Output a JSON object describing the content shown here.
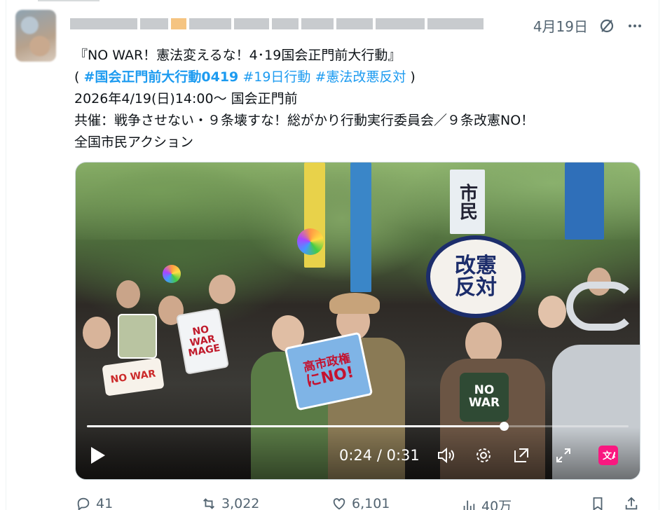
{
  "header": {
    "date": "4月19日",
    "grok_icon": "grok-slash-icon",
    "more_icon": "more-dots-icon"
  },
  "tweet": {
    "line1": "『NO WAR！憲法変えるな！4･19国会正門前大行動』",
    "line2_open": "( ",
    "hashtag1": "#国会正門前大行動0419",
    "hashtag2": "#19日行動",
    "hashtag3": "#憲法改悪反対",
    "line2_close": " )",
    "line3": "2026年4/19(日)14:00～ 国会正門前",
    "line4": "共催：戦争させない・９条壊すな！総がかり行動実行委員会／９条改憲NO！",
    "line5": "全国市民アクション"
  },
  "video": {
    "time": "0:24 / 0:31",
    "progress_fraction": 0.77,
    "sign_main_line1": "改憲",
    "sign_main_line2": "反対",
    "sign_blue_line1": "高市政権",
    "sign_blue_line2": "にNO!",
    "sign_white": "NO WAR MAGE",
    "sign_pink": "NO WAR",
    "shirt_text": "NO WAR",
    "banner_text": "市民"
  },
  "actions": {
    "replies": "41",
    "retweets": "3,022",
    "likes": "6,101",
    "views": "40万"
  },
  "colors": {
    "link": "#1d9bf0",
    "muted": "#536471",
    "caption_button": "#f91880"
  }
}
